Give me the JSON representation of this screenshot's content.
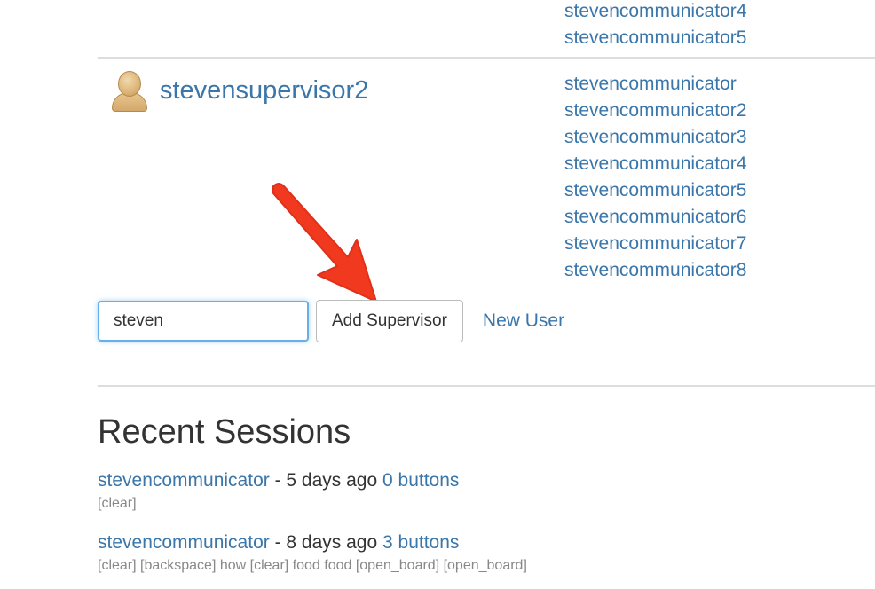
{
  "top_communicators": [
    "stevencommunicator4",
    "stevencommunicator5"
  ],
  "supervisor": {
    "name": "stevensupervisor2",
    "communicators": [
      "stevencommunicator",
      "stevencommunicator2",
      "stevencommunicator3",
      "stevencommunicator4",
      "stevencommunicator5",
      "stevencommunicator6",
      "stevencommunicator7",
      "stevencommunicator8"
    ]
  },
  "add_form": {
    "input_value": "steven",
    "add_button_label": "Add Supervisor",
    "new_user_label": "New User"
  },
  "recent_sessions": {
    "title": "Recent Sessions",
    "items": [
      {
        "user": "stevencommunicator",
        "separator": " - ",
        "time": "5 days ago",
        "buttons": "0 buttons",
        "detail": "[clear]"
      },
      {
        "user": "stevencommunicator",
        "separator": " - ",
        "time": "8 days ago",
        "buttons": "3 buttons",
        "detail": "[clear] [backspace] how [clear] food food [open_board] [open_board]"
      }
    ]
  },
  "colors": {
    "link": "#3a76aa",
    "arrow": "#f0391f",
    "input_focus": "#66afe9",
    "divider": "#dddddd"
  },
  "icons": {
    "avatar": "user-avatar-icon",
    "annotation": "red-arrow-annotation"
  }
}
